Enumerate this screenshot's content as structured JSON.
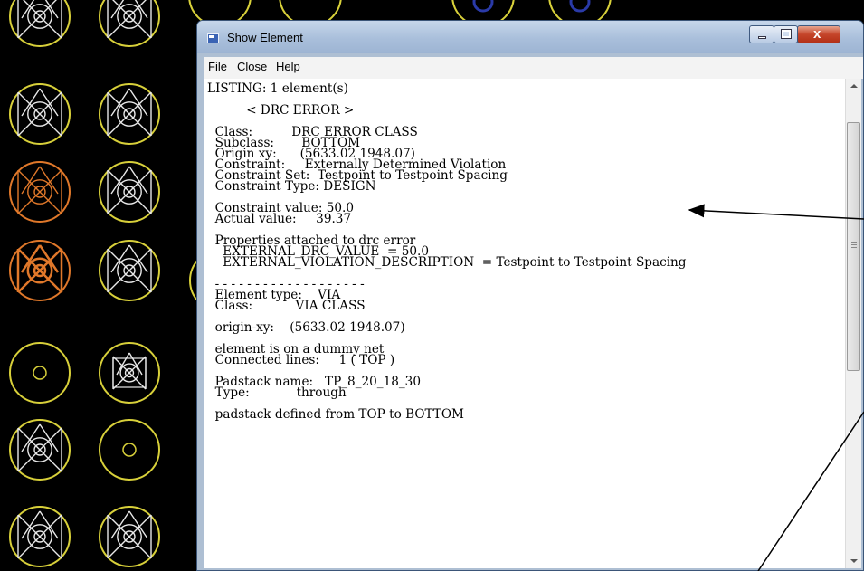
{
  "window": {
    "title": "Show Element",
    "close_glyph": "x"
  },
  "menu": {
    "items": [
      "File",
      "Close",
      "Help"
    ]
  },
  "listing": {
    "lines": [
      "LISTING: 1 element(s)",
      "",
      "          < DRC ERROR >",
      "",
      "  Class:          DRC ERROR CLASS",
      "  Subclass:       BOTTOM",
      "  Origin xy:      (5633.02 1948.07)",
      "  Constraint:     Externally Determined Violation",
      "  Constraint Set:  Testpoint to Testpoint Spacing",
      "  Constraint Type: DESIGN",
      "",
      "  Constraint value: 50.0",
      "  Actual value:     39.37",
      "",
      "  Properties attached to drc error",
      "    EXTERNAL_DRC_VALUE  = 50.0",
      "    EXTERNAL_VIOLATION_DESCRIPTION  = Testpoint to Testpoint Spacing",
      "",
      "  - - - - - - - - - - - - - - - - - - -",
      "  Element type:    VIA",
      "  Class:           VIA CLASS",
      "",
      "  origin-xy:    (5633.02 1948.07)",
      "",
      "  element is on a dummy net",
      "  Connected lines:     1 ( TOP )",
      "",
      "  Padstack name:   TP_8_20_18_30",
      "  Type:            through",
      "",
      "  padstack defined from TOP to BOTTOM"
    ]
  },
  "scrollbar": {
    "position": 0.0
  },
  "colors": {
    "background": "#000000",
    "pad_yellow": "#d8d03a",
    "pad_white": "#e8e8e8",
    "pad_orange": "#e0782a",
    "pad_blue": "#2a3aa8"
  },
  "background_canvas": {
    "pads": [
      {
        "variant": "via"
      },
      {
        "variant": "via"
      },
      {
        "variant": "via"
      },
      {
        "variant": "via"
      },
      {
        "variant": "via-orange"
      },
      {
        "variant": "via"
      },
      {
        "variant": "via-orange-fill"
      },
      {
        "variant": "via"
      },
      {
        "variant": "hole"
      },
      {
        "variant": "via-small"
      },
      {
        "variant": "via"
      },
      {
        "variant": "hole"
      },
      {
        "variant": "via"
      },
      {
        "variant": "via"
      }
    ]
  }
}
